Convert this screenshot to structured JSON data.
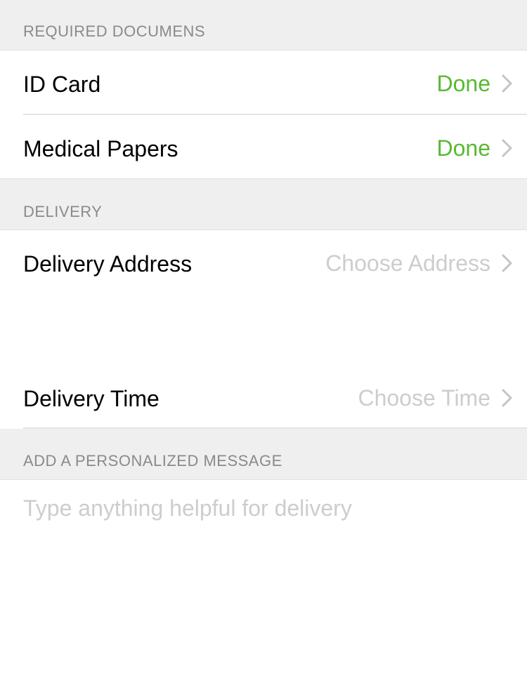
{
  "colors": {
    "done_green": "#5ab833",
    "placeholder_gray": "#cdcdcd",
    "header_bg": "#efefef",
    "header_text": "#8a8a8a"
  },
  "required_documents": {
    "header": "REQUIRED DOCUMENS",
    "rows": [
      {
        "label": "ID Card",
        "status": "Done",
        "icon": "chevron-right-icon"
      },
      {
        "label": "Medical Papers",
        "status": "Done",
        "icon": "chevron-right-icon"
      }
    ]
  },
  "delivery": {
    "header": "DELIVERY",
    "address": {
      "label": "Delivery Address",
      "placeholder": "Choose Address",
      "icon": "chevron-right-icon"
    },
    "time": {
      "label": "Delivery Time",
      "placeholder": "Choose Time",
      "icon": "chevron-right-icon"
    }
  },
  "message": {
    "header": "ADD A PERSONALIZED MESSAGE",
    "placeholder": "Type anything helpful for delivery",
    "value": ""
  }
}
